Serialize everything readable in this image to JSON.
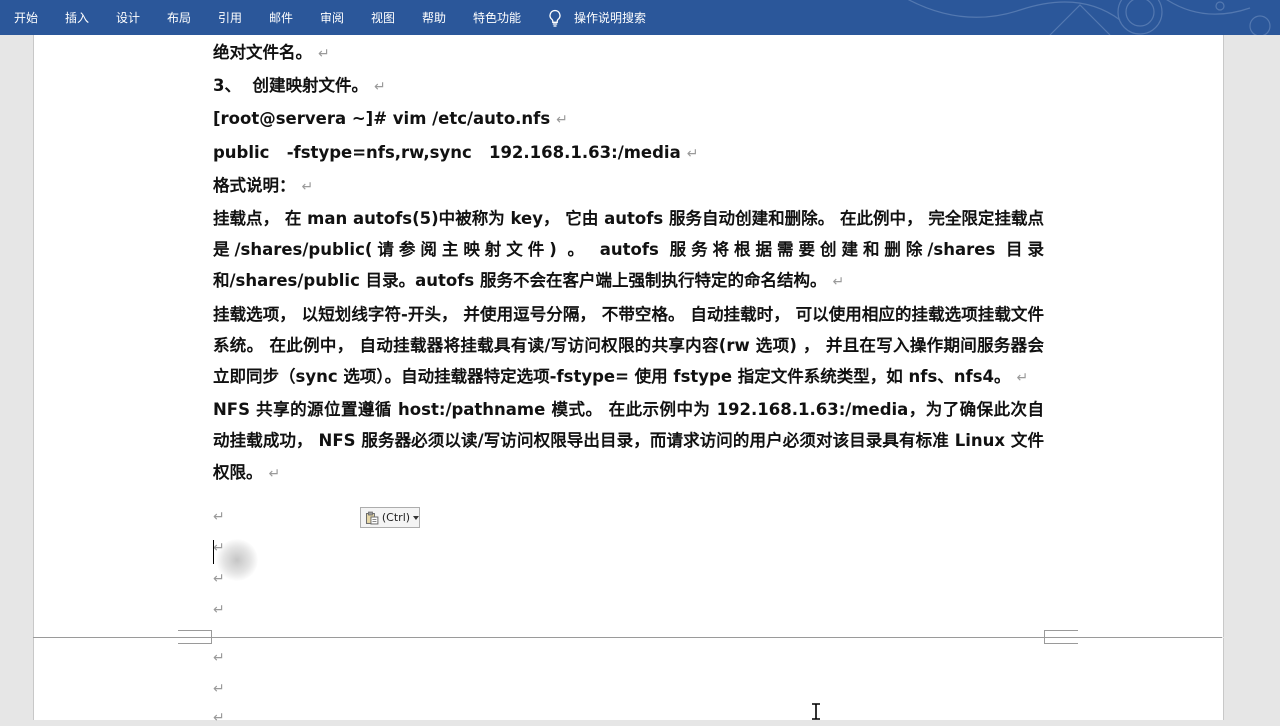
{
  "ribbon": {
    "tabs": [
      "开始",
      "插入",
      "设计",
      "布局",
      "引用",
      "邮件",
      "审阅",
      "视图",
      "帮助",
      "特色功能"
    ],
    "tell_me": "操作说明搜索",
    "icon": "lightbulb-icon",
    "color": "#2b579a"
  },
  "document": {
    "line1": "绝对文件名。",
    "line2_num": "3、",
    "line2_text": "创建映射文件。",
    "line3": "[root@servera ~]# vim /etc/auto.nfs",
    "line4_a": "public",
    "line4_b": "-fstype=nfs,rw,sync",
    "line4_c": "192.168.1.63:/media",
    "line5": "格式说明：",
    "para1": "挂载点， 在 man autofs(5)中被称为 key， 它由 autofs 服务自动创建和删除。 在此例中， 完全限定挂载点是/shares/public(请参阅主映射文件) 。 autofs 服务将根据需要创建和删除/shares 目录和/shares/public 目录。autofs 服务不会在客户端上强制执行特定的命名结构。",
    "para2": "挂载选项， 以短划线字符-开头， 并使用逗号分隔， 不带空格。 自动挂载时， 可以使用相应的挂载选项挂载文件系统。 在此例中， 自动挂载器将挂载具有读/写访问权限的共享内容(rw 选项) ， 并且在写入操作期间服务器会立即同步（sync 选项）。自动挂载器特定选项-fstype= 使用 fstype 指定文件系统类型，如 nfs、nfs4。",
    "para3": "NFS 共享的源位置遵循 host:/pathname 模式。 在此示例中为 192.168.1.63:/media，为了确保此次自动挂载成功， NFS 服务器必须以读/写访问权限导出目录，而请求访问的用户必须对该目录具有标准 Linux 文件权限。",
    "paragraph_mark": "↵"
  },
  "paste_options": {
    "label": "(Ctrl)",
    "icon": "clipboard-icon"
  }
}
